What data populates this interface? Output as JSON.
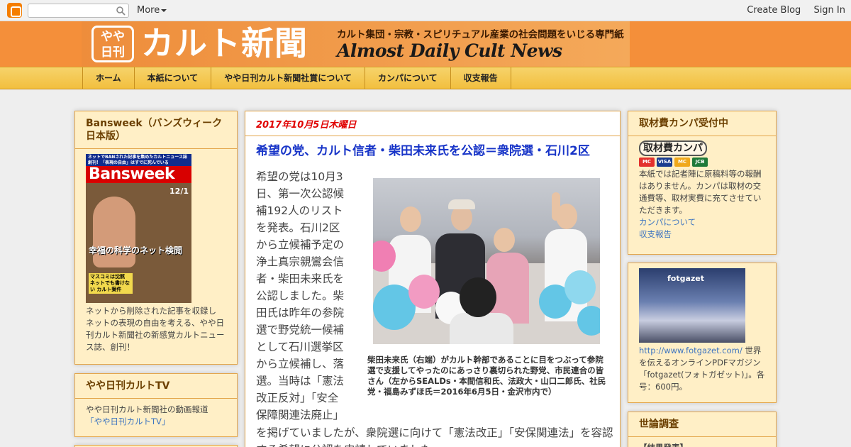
{
  "navbar": {
    "more_label": "More",
    "create_blog": "Create Blog",
    "sign_in": "Sign In"
  },
  "header": {
    "badge_line1": "やや",
    "badge_line2": "日刊",
    "title": "カルト新聞",
    "subtitle": "カルト集団・宗教・スピリチュアル産業の社会問題をいじる専門紙",
    "english": "Almost Daily Cult News"
  },
  "menu": {
    "items": [
      "ホーム",
      "本紙について",
      "やや日刊カルト新聞社賞について",
      "カンパについて",
      "収支報告"
    ]
  },
  "left": {
    "bansweek": {
      "title": "Bansweek（バンズウィーク日本版）",
      "cover_top": "ネットでBANされた記事を集めたカルトニュース誌創刊！「表現の自由」はすでに死んでいる",
      "cover_brand": "Bansweek",
      "cover_date": "12/1",
      "cover_headline": "幸福の科学のネット検閲",
      "cover_box": "マスコミは沈黙 ネットでも書けない カルト案件",
      "description": "ネットから削除された記事を収録し ネットの表現の自由を考える、やや日刊カルト新聞社の新感覚カルトニュース誌、創刊！"
    },
    "tv": {
      "title": "やや日刊カルトTV",
      "description": "やや日刊カルト新聞社の動画報道",
      "link": "「やや日刊カルトTV」"
    }
  },
  "post": {
    "date": "2017年10月5日木曜日",
    "title": "希望の党、カルト信者・柴田未来氏を公認＝衆院選・石川2区",
    "body_lines": [
      "希望の党は10月3",
      "日、第一次公認候",
      "補192人のリスト",
      "を発表。石川2区",
      "から立候補予定の",
      "浄土真宗親鸞会信",
      "者・柴田未来氏を",
      "公認しました。柴",
      "田氏は昨年の参院",
      "選で野党統一候補",
      "として石川選挙区",
      "から立候補し、落",
      "選。当時は「憲法",
      "改正反対」「安全",
      "保障関連法廃止」"
    ],
    "body_bottom": "を掲げていましたが、衆院選に向けて「憲法改正」「安保関連法」を容認する希望に公認を申請していました。",
    "caption": "柴田未来氏（右端）がカルト幹部であることに目をつぶって参院選で支援してやったのにあっさり裏切られた野党、市民連合の皆さん（左からSEALDs・本間信和氏、法政大・山口二郎氏、社民党・福島みずほ氏＝2016年6月5日・金沢市内で）"
  },
  "right": {
    "kanpa": {
      "title": "取材費カンパ受付中",
      "button": "取材費カンパ",
      "cards": [
        "MC",
        "VISA",
        "MC",
        "JCB"
      ],
      "description": "本紙では記者陣に原稿料等の報酬はありません。カンパは取材の交通費等、取材実費に充てさせていただきます。",
      "link1": "カンパについて",
      "link2": "収支報告"
    },
    "fotgazet": {
      "logo": "fotgazet",
      "url": "http://www.fotgazet.com/",
      "description": "世界を伝えるオンラインPDFマガジン「fotgazet(フォトガゼット)」。各号：600円。"
    },
    "poll": {
      "title": "世論調査",
      "body": "【結果発表】"
    }
  },
  "colors": {
    "header_orange": "#f48f3a",
    "menu_gold": "#f2bf3e",
    "panel_bg": "#ffefc6",
    "date_red": "#e00000",
    "title_blue": "#1734c8"
  }
}
